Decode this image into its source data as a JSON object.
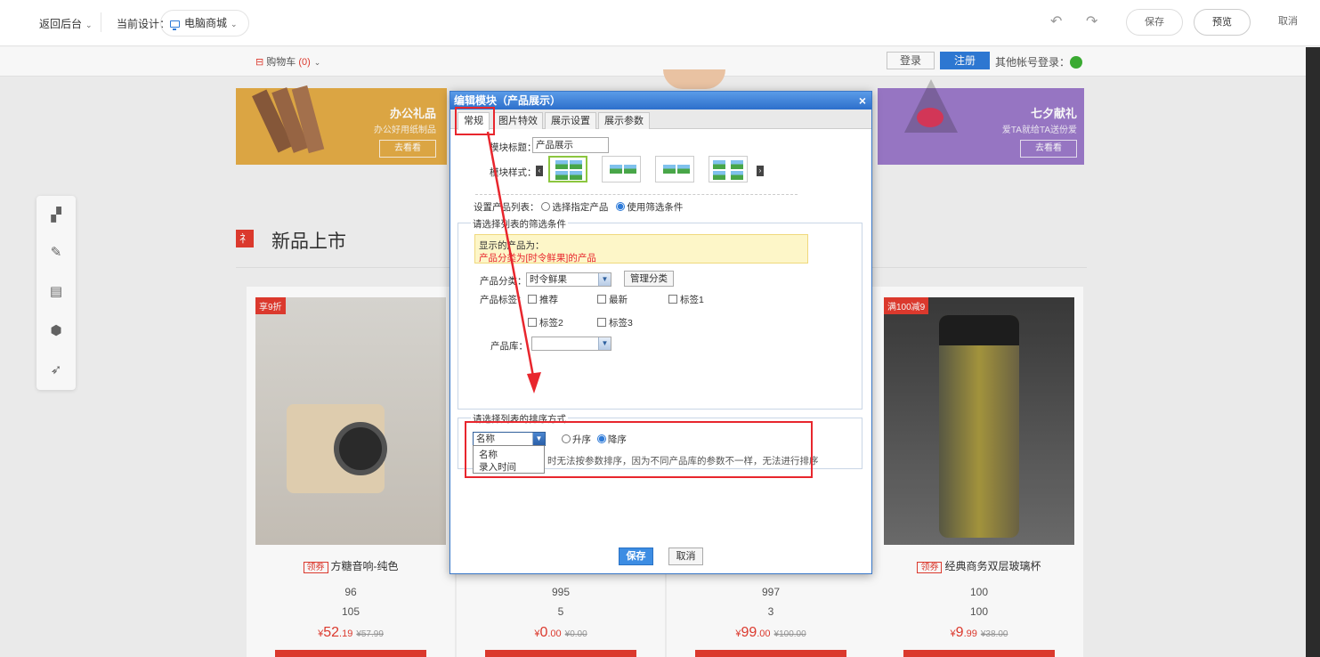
{
  "topbar": {
    "back_label": "返回后台",
    "current_design_label": "当前设计：",
    "device_label": "电脑商城",
    "undo_icon": "undo-icon",
    "redo_icon": "redo-icon",
    "save_label": "保存",
    "preview_label": "预览",
    "cancel_label": "取消"
  },
  "siteheader": {
    "cart_label": "购物车",
    "cart_count": "(0)",
    "login_label": "登录",
    "register_label": "注册",
    "other_login_label": "其他帐号登录："
  },
  "banners": [
    {
      "title": "办公礼品",
      "subtitle": "办公好用纸制品",
      "button": "去看看",
      "color": "#e3ab46"
    },
    {
      "title": "七夕献礼",
      "subtitle": "爱TA就给TA送份爱",
      "button": "去看看",
      "color": "#9b79c9"
    }
  ],
  "section": {
    "title": "新品上市"
  },
  "products": [
    {
      "tag": "享9折",
      "coupon": "领券",
      "name": "方糖音响-纯色",
      "n1": "96",
      "n2": "105",
      "price_int": "52",
      "price_dec": ".19",
      "price_old": "¥57.99"
    },
    {
      "tag": "",
      "coupon": "",
      "name": "",
      "n1": "995",
      "n2": "5",
      "price_int": "0",
      "price_dec": ".00",
      "price_old": "¥0.00"
    },
    {
      "tag": "",
      "coupon": "",
      "name": "",
      "n1": "997",
      "n2": "3",
      "price_int": "99",
      "price_dec": ".00",
      "price_old": "¥100.00"
    },
    {
      "tag": "满100减9",
      "coupon": "领券",
      "name": "经典商务双层玻璃杯",
      "n1": "100",
      "n2": "100",
      "price_int": "9",
      "price_dec": ".99",
      "price_old": "¥38.00"
    }
  ],
  "currency": "¥",
  "dialog": {
    "title": "编辑模块（产品展示）",
    "close": "×",
    "tabs": [
      "常规",
      "图片特效",
      "展示设置",
      "展示参数"
    ],
    "module_title_label": "模块标题：",
    "module_title_value": "产品展示",
    "module_style_label": "模块样式：",
    "product_list_label": "设置产品列表：",
    "product_list_option1": "选择指定产品",
    "product_list_option2": "使用筛选条件",
    "filter_legend": "请选择列表的筛选条件",
    "notice_line1": "显示的产品为：",
    "notice_line2": "产品分类为[时令鲜果]的产品",
    "category_label": "产品分类：",
    "category_value": "时令鲜果",
    "manage_category": "管理分类",
    "tag_label": "产品标签：",
    "tags": [
      "推荐",
      "最新",
      "标签1",
      "标签2",
      "标签3"
    ],
    "library_label": "产品库：",
    "library_value": "",
    "sort_legend": "请选择列表的排序方式",
    "sort_value": "名称",
    "sort_asc": "升序",
    "sort_desc": "降序",
    "sort_note": "时无法按参数排序，因为不同产品库的参数不一样，无法进行排序",
    "sort_options": [
      "名称",
      "录入时间"
    ],
    "save": "保存",
    "cancel": "取消"
  }
}
